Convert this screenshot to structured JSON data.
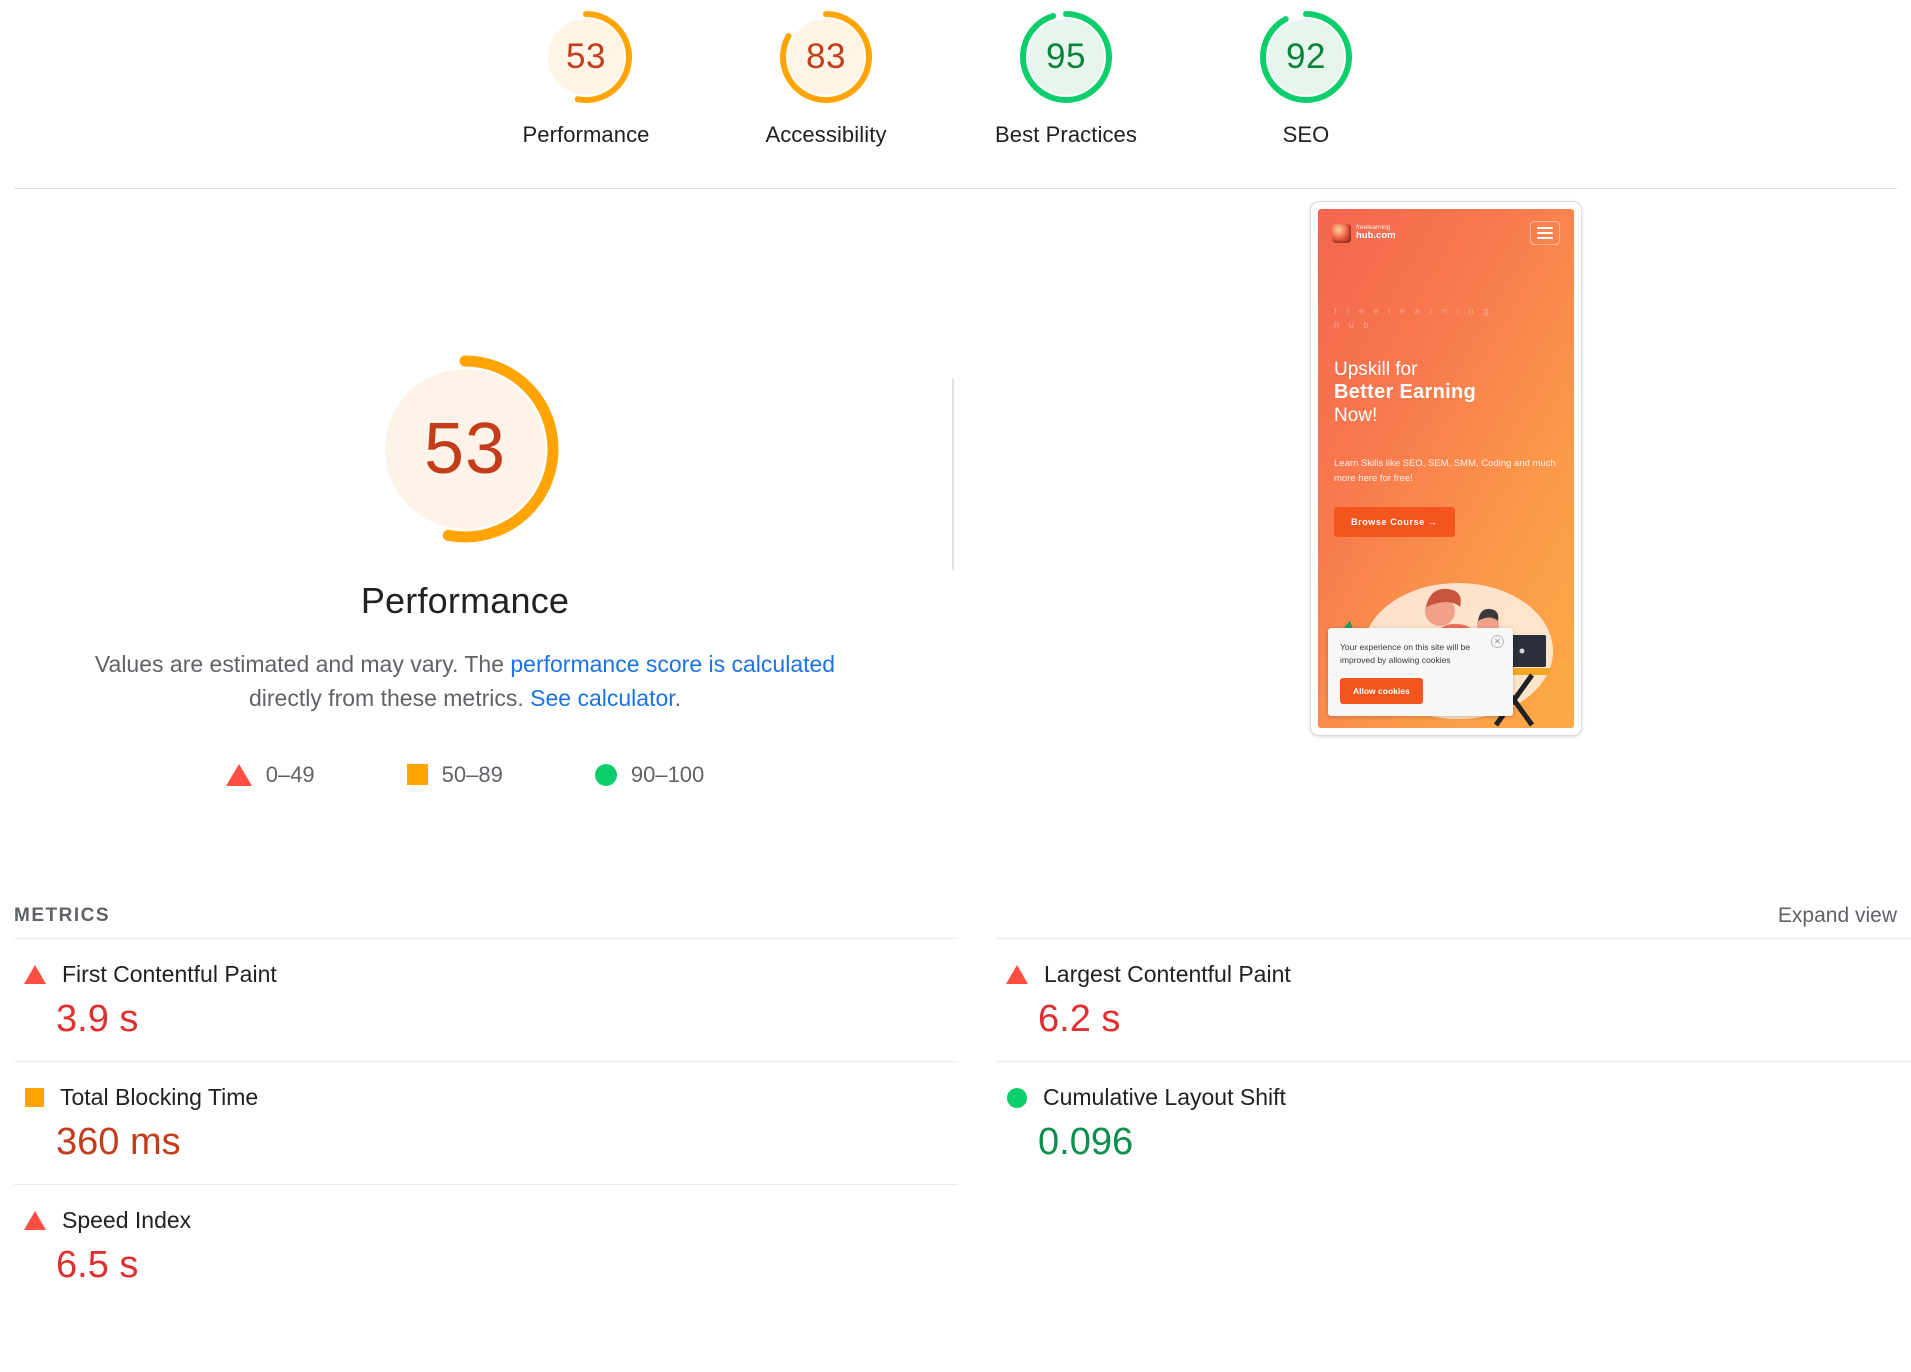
{
  "colors": {
    "orange": "#ffa400",
    "orange_text": "#c33d1b",
    "orange_bg": "#fff4e5",
    "green": "#0cce6b",
    "green_text": "#07843b",
    "green_bg": "#e8f5ec",
    "red": "#ff4e42",
    "red_text": "#e02f2f",
    "link": "#1a73e8",
    "muted": "#5f6368"
  },
  "summary": {
    "items": [
      {
        "score": "53",
        "label": "Performance",
        "rating": "average"
      },
      {
        "score": "83",
        "label": "Accessibility",
        "rating": "average"
      },
      {
        "score": "95",
        "label": "Best Practices",
        "rating": "good"
      },
      {
        "score": "92",
        "label": "SEO",
        "rating": "good"
      }
    ]
  },
  "hero": {
    "score": "53",
    "rating": "average",
    "title": "Performance",
    "desc_part1": "Values are estimated and may vary. The ",
    "desc_link1": "performance score is calculated",
    "desc_part2": " directly from these metrics. ",
    "desc_link2": "See calculator",
    "desc_part3": ".",
    "legend": [
      {
        "icon": "triangle-red-icon",
        "range": "0–49"
      },
      {
        "icon": "square-orange-icon",
        "range": "50–89"
      },
      {
        "icon": "circle-green-icon",
        "range": "90–100"
      }
    ]
  },
  "thumbnail": {
    "brand_line1": "freelearning",
    "brand_line2": "hub.com",
    "ghost_line1": "f r e e    l e a r n i n g",
    "ghost_line2": "h u b .",
    "headline1": "Upskill for",
    "headline2": "Better Earning",
    "headline3": "Now!",
    "subtext": "Learn Skills like SEO, SEM, SMM, Coding and much more here for free!",
    "cta": "Browse Course →",
    "cookie_text": "Your experience on this site will be improved by allowing cookies",
    "cookie_button": "Allow cookies",
    "cookie_close": "✕"
  },
  "metrics": {
    "title": "METRICS",
    "expand_view": "Expand view",
    "items": [
      {
        "label": "First Contentful Paint",
        "value": "3.9 s",
        "rating": "poor",
        "icon": "triangle-red-icon"
      },
      {
        "label": "Largest Contentful Paint",
        "value": "6.2 s",
        "rating": "poor",
        "icon": "triangle-red-icon"
      },
      {
        "label": "Total Blocking Time",
        "value": "360 ms",
        "rating": "average",
        "icon": "square-orange-icon"
      },
      {
        "label": "Cumulative Layout Shift",
        "value": "0.096",
        "rating": "good",
        "icon": "circle-green-icon"
      },
      {
        "label": "Speed Index",
        "value": "6.5 s",
        "rating": "poor",
        "icon": "triangle-red-icon"
      }
    ]
  }
}
